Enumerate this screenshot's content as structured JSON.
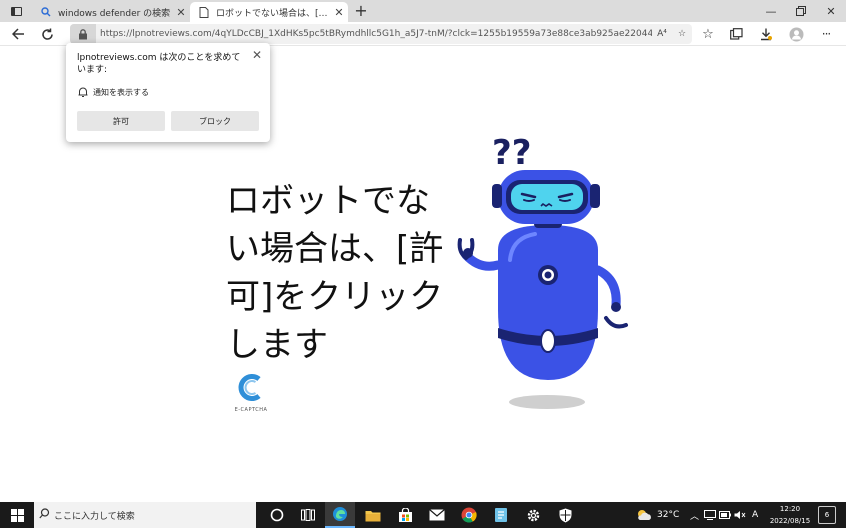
{
  "browser": {
    "tabs": [
      {
        "title": "windows defender の検索",
        "icon": "search-icon"
      },
      {
        "title": "ロボットでない場合は、[許可]をクリッ",
        "icon": "page-icon"
      }
    ],
    "address_url": "https://lpnotreviews.com/4qYLDcCBJ_1XdHKs5pc5tBRymdhllc5G1h_a5J7-tnM/?clck=1255b19559a73e88ce3ab925ae220445&sid=1...",
    "read_aloud": "A⁴"
  },
  "permission_popup": {
    "title": "lpnotreviews.com は次のことを求めています:",
    "request": "通知を表示する",
    "allow_label": "許可",
    "block_label": "ブロック"
  },
  "page": {
    "headline_lines": [
      "ロボットでな",
      "い場合は、[許",
      "可]をクリック",
      "します"
    ],
    "captcha_label": "E-CAPTCHA",
    "robot_question": "??"
  },
  "taskbar": {
    "search_placeholder": "ここに入力して検索",
    "weather": "32°C",
    "ime": "A",
    "time": "12:20",
    "date": "2022/08/15",
    "notification_count": "6"
  },
  "colors": {
    "robot_blue": "#3b52e6",
    "robot_dark": "#1a2472",
    "visor": "#4fd3ee"
  }
}
